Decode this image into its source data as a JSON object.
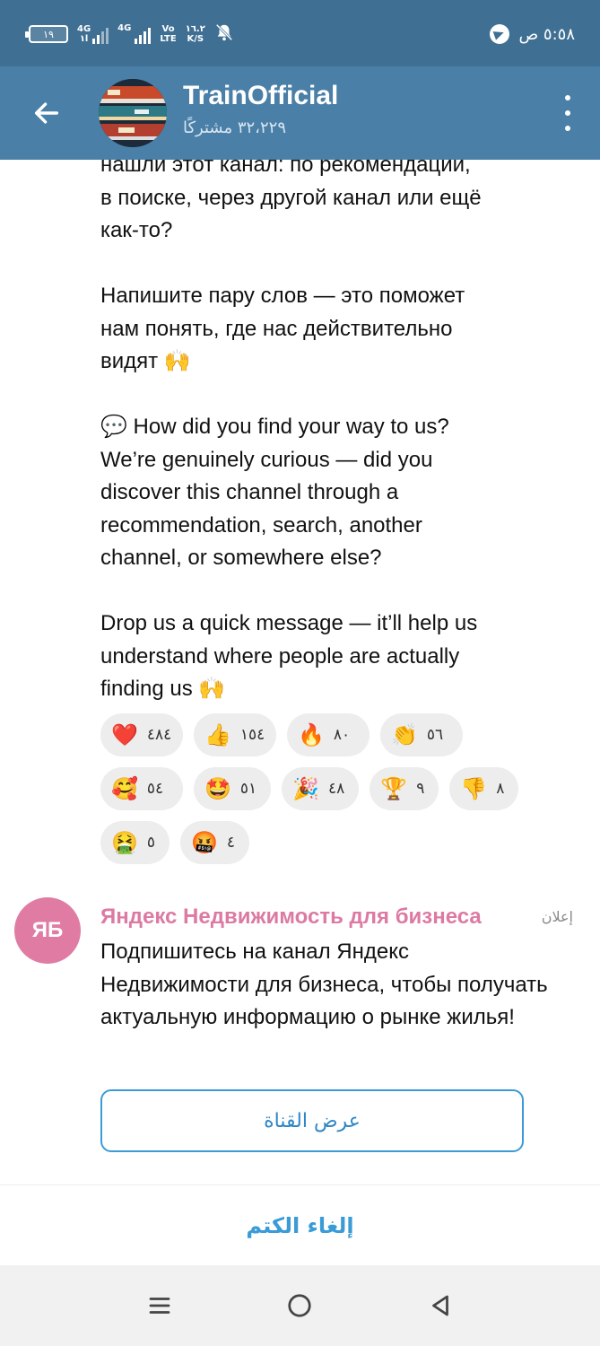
{
  "status_bar": {
    "battery": "١٩",
    "network1": "4G",
    "network1_sub": "١l",
    "network2": "4G",
    "volte_top": "Vo",
    "volte_bottom": "LTE",
    "speed_top": "١٦.٢",
    "speed_bottom": "K/S",
    "time": "٥:٥٨ ص",
    "telegram_icon": "telegram-icon",
    "mute_icon": "bell-off-icon"
  },
  "header": {
    "title": "TrainOfficial",
    "subscribers": "٣٢،٢٢٩ مشتركًا",
    "back_icon": "arrow-left-icon",
    "menu_icon": "more-vertical-icon"
  },
  "post": {
    "paragraph1": "нашли этот канал: по рекомендации,\nв поиске, через другой канал или ещё\nкак-то?",
    "paragraph2": "Напишите пару слов — это поможет\nнам понять, где нас действительно\nвидят 🙌",
    "paragraph3": "💬 How did you find your way to us?\nWe’re genuinely curious — did you\ndiscover this channel through a\nrecommendation, search, another\nchannel, or somewhere else?",
    "paragraph4": "Drop us a quick message — it’ll help us\nunderstand where people are actually\nfinding us 🙌"
  },
  "reactions": [
    {
      "emoji": "❤️",
      "count": "٤٨٤"
    },
    {
      "emoji": "👍",
      "count": "١٥٤"
    },
    {
      "emoji": "🔥",
      "count": "٨٠"
    },
    {
      "emoji": "👏",
      "count": "٥٦"
    },
    {
      "emoji": "🥰",
      "count": "٥٤"
    },
    {
      "emoji": "🤩",
      "count": "٥١"
    },
    {
      "emoji": "🎉",
      "count": "٤٨"
    },
    {
      "emoji": "🏆",
      "count": "٩"
    },
    {
      "emoji": "👎",
      "count": "٨"
    },
    {
      "emoji": "🤮",
      "count": "٥"
    },
    {
      "emoji": "🤬",
      "count": "٤"
    }
  ],
  "ad": {
    "avatar_initials": "ЯБ",
    "name": "Яндекс Недвижимость для бизнеса",
    "label": "إعلان",
    "text": "Подпишитесь на канал Яндекс Недвижимости для бизнеса, чтобы получать актуальную информацию о рынке жилья!",
    "button": "عرض القناة"
  },
  "unmute": "إلغاء الكتم",
  "navbar": {
    "recents_icon": "recents-icon",
    "home_icon": "home-circle-icon",
    "back_icon": "back-triangle-icon"
  },
  "colors": {
    "status_bar": "#3f6f93",
    "header": "#4a7fa7",
    "accent": "#3a9bd7",
    "ad_name": "#dc7aa3",
    "ad_avatar": "#e07ca4"
  }
}
